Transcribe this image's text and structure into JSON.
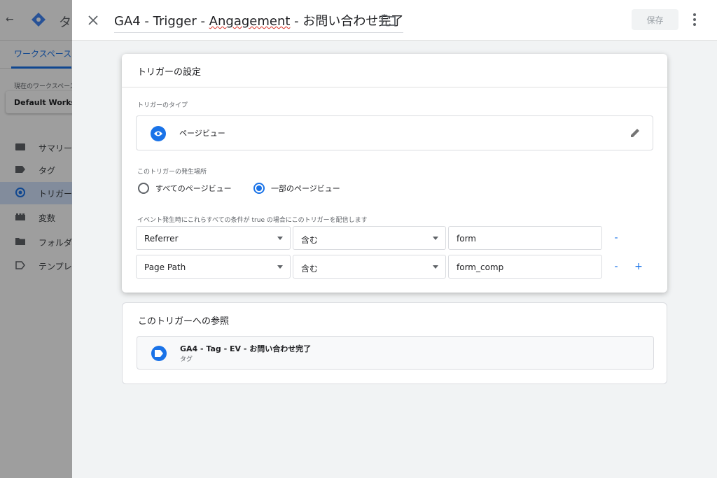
{
  "background": {
    "app_title": "タ",
    "workspace_tab": "ワークスペース",
    "workspace_label": "現在のワークスペース",
    "workspace_name": "Default Workspace",
    "nav": [
      {
        "label": "サマリー",
        "icon": "summary-icon"
      },
      {
        "label": "タグ",
        "icon": "tag-icon"
      },
      {
        "label": "トリガー",
        "icon": "trigger-icon",
        "active": true
      },
      {
        "label": "変数",
        "icon": "variables-icon"
      },
      {
        "label": "フォルダ",
        "icon": "folder-icon"
      },
      {
        "label": "テンプレート",
        "icon": "template-icon"
      }
    ]
  },
  "header": {
    "title_prefix": "GA4 - Trigger - ",
    "title_misspelled": "Angagement",
    "title_suffix": " - お問い合わせ完了",
    "save_label": "保存"
  },
  "config": {
    "heading": "トリガーの設定",
    "type_label": "トリガーのタイプ",
    "type_name": "ページビュー",
    "fires_on_label": "このトリガーの発生場所",
    "radio_all": "すべてのページビュー",
    "radio_some": "一部のページビュー",
    "conditions_label": "イベント発生時にこれらすべての条件が true の場合にこのトリガーを配信します",
    "conditions": [
      {
        "variable": "Referrer",
        "operator": "含む",
        "value": "form",
        "remove": "-"
      },
      {
        "variable": "Page Path",
        "operator": "含む",
        "value": "form_comp",
        "remove": "-",
        "add": "+"
      }
    ]
  },
  "references": {
    "heading": "このトリガーへの参照",
    "item_name": "GA4 - Tag - EV - お問い合わせ完了",
    "item_type": "タグ"
  },
  "colors": {
    "accent": "#1a73e8",
    "overlay": "rgba(0,0,0,0.38)"
  }
}
